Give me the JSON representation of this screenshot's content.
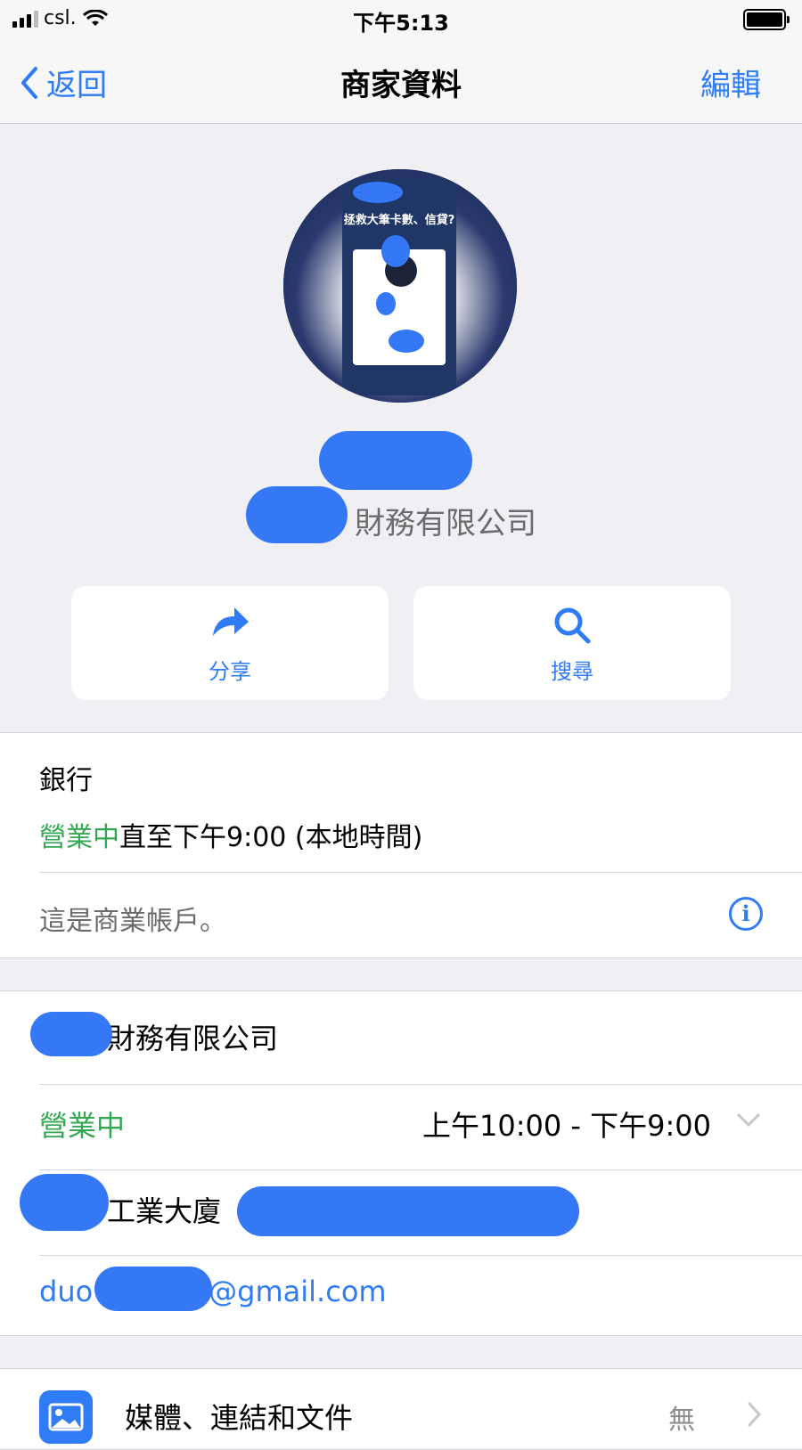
{
  "status_bar": {
    "carrier": "csl.",
    "time": "下午5:13"
  },
  "nav": {
    "back_label": "返回",
    "title": "商家資料",
    "edit_label": "編輯"
  },
  "profile": {
    "company_name_suffix": "財務有限公司",
    "poster_title": "拯救大筆卡數、信貸?"
  },
  "actions": [
    {
      "label": "分享",
      "icon": "share-arrow-icon"
    },
    {
      "label": "搜尋",
      "icon": "magnifier-icon"
    }
  ],
  "summary": {
    "category": "銀行",
    "open_status": "營業中",
    "hours_text": "直至下午9:00 (本地時間)",
    "business_note": "這是商業帳戶。"
  },
  "details": {
    "name_suffix": "財務有限公司",
    "open_status": "營業中",
    "hours": "上午10:00 - 下午9:00",
    "address_visible": "工業大廈",
    "email_prefix": "duo",
    "email_suffix": "@gmail.com"
  },
  "media": {
    "label": "媒體、連結和文件",
    "value": "無"
  },
  "colors": {
    "accent": "#2f7cf6",
    "open_green": "#33a853",
    "background": "#efeff4"
  }
}
